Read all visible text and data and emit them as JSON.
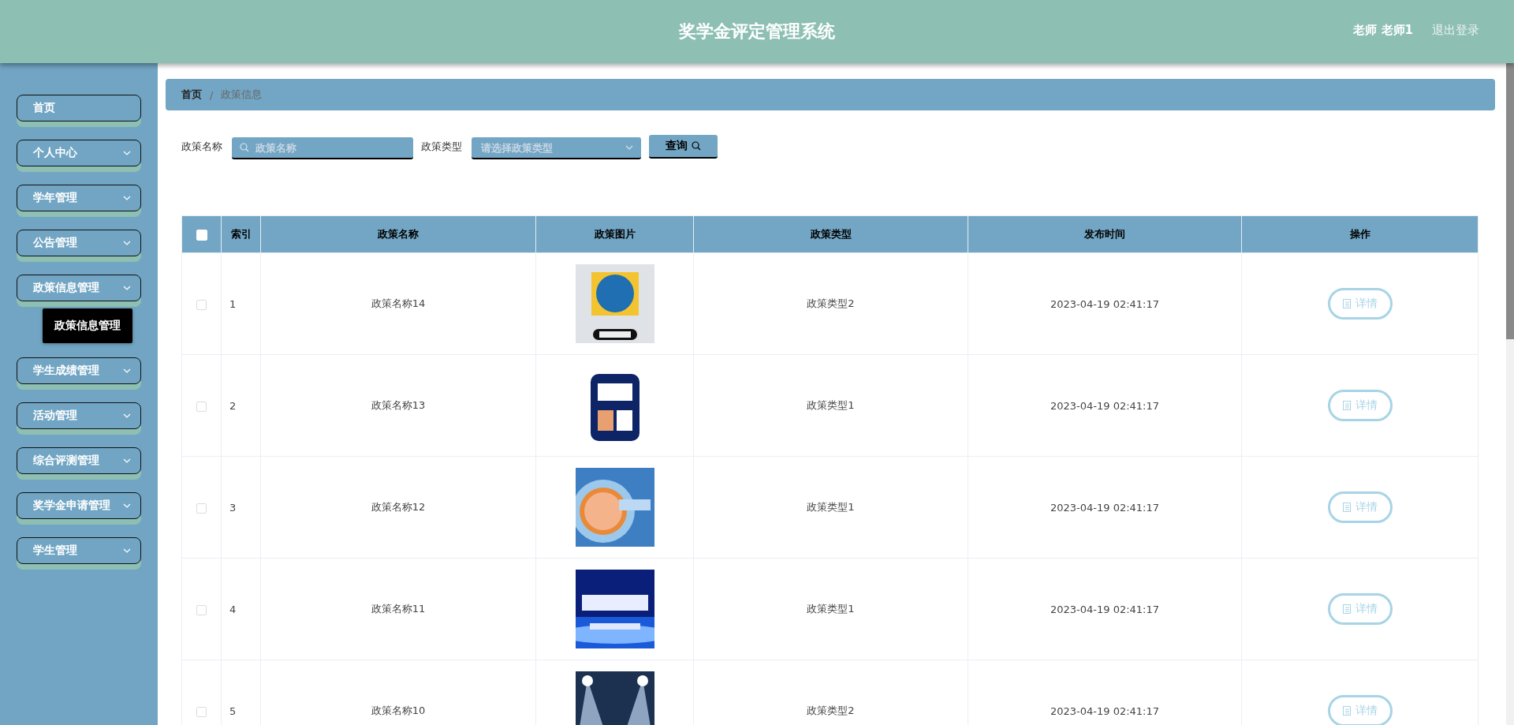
{
  "header": {
    "title": "奖学金评定管理系统",
    "user": "老师 老师1",
    "logout": "退出登录"
  },
  "sidebar": {
    "items": [
      {
        "label": "首页",
        "kind": "link"
      },
      {
        "label": "个人中心",
        "kind": "menu"
      },
      {
        "label": "学年管理",
        "kind": "menu"
      },
      {
        "label": "公告管理",
        "kind": "menu"
      },
      {
        "label": "政策信息管理",
        "kind": "menu",
        "children": [
          {
            "label": "政策信息管理",
            "selected": true
          }
        ]
      },
      {
        "label": "学生成绩管理",
        "kind": "menu"
      },
      {
        "label": "活动管理",
        "kind": "menu"
      },
      {
        "label": "综合评测管理",
        "kind": "menu"
      },
      {
        "label": "奖学金申请管理",
        "kind": "menu"
      },
      {
        "label": "学生管理",
        "kind": "menu"
      }
    ]
  },
  "breadcrumb": {
    "separator": "/",
    "items": [
      "首页",
      "政策信息"
    ]
  },
  "search": {
    "name_label": "政策名称",
    "name_placeholder": "政策名称",
    "type_label": "政策类型",
    "type_placeholder": "请选择政策类型",
    "button": "查询"
  },
  "table": {
    "select_all": {
      "checked": false
    },
    "columns": [
      "索引",
      "政策名称",
      "政策图片",
      "政策类型",
      "发布时间",
      "操作"
    ],
    "rows": [
      {
        "checked": false,
        "index": "1",
        "name": "政策名称14",
        "type": "政策类型2",
        "time": "2023-04-19 02:41:17",
        "action": "详情"
      },
      {
        "checked": false,
        "index": "2",
        "name": "政策名称13",
        "type": "政策类型1",
        "time": "2023-04-19 02:41:17",
        "action": "详情"
      },
      {
        "checked": false,
        "index": "3",
        "name": "政策名称12",
        "type": "政策类型1",
        "time": "2023-04-19 02:41:17",
        "action": "详情"
      },
      {
        "checked": false,
        "index": "4",
        "name": "政策名称11",
        "type": "政策类型1",
        "time": "2023-04-19 02:41:17",
        "action": "详情"
      },
      {
        "checked": false,
        "index": "5",
        "name": "政策名称10",
        "type": "政策类型2",
        "time": "2023-04-19 02:41:17",
        "action": "详情"
      }
    ]
  }
}
